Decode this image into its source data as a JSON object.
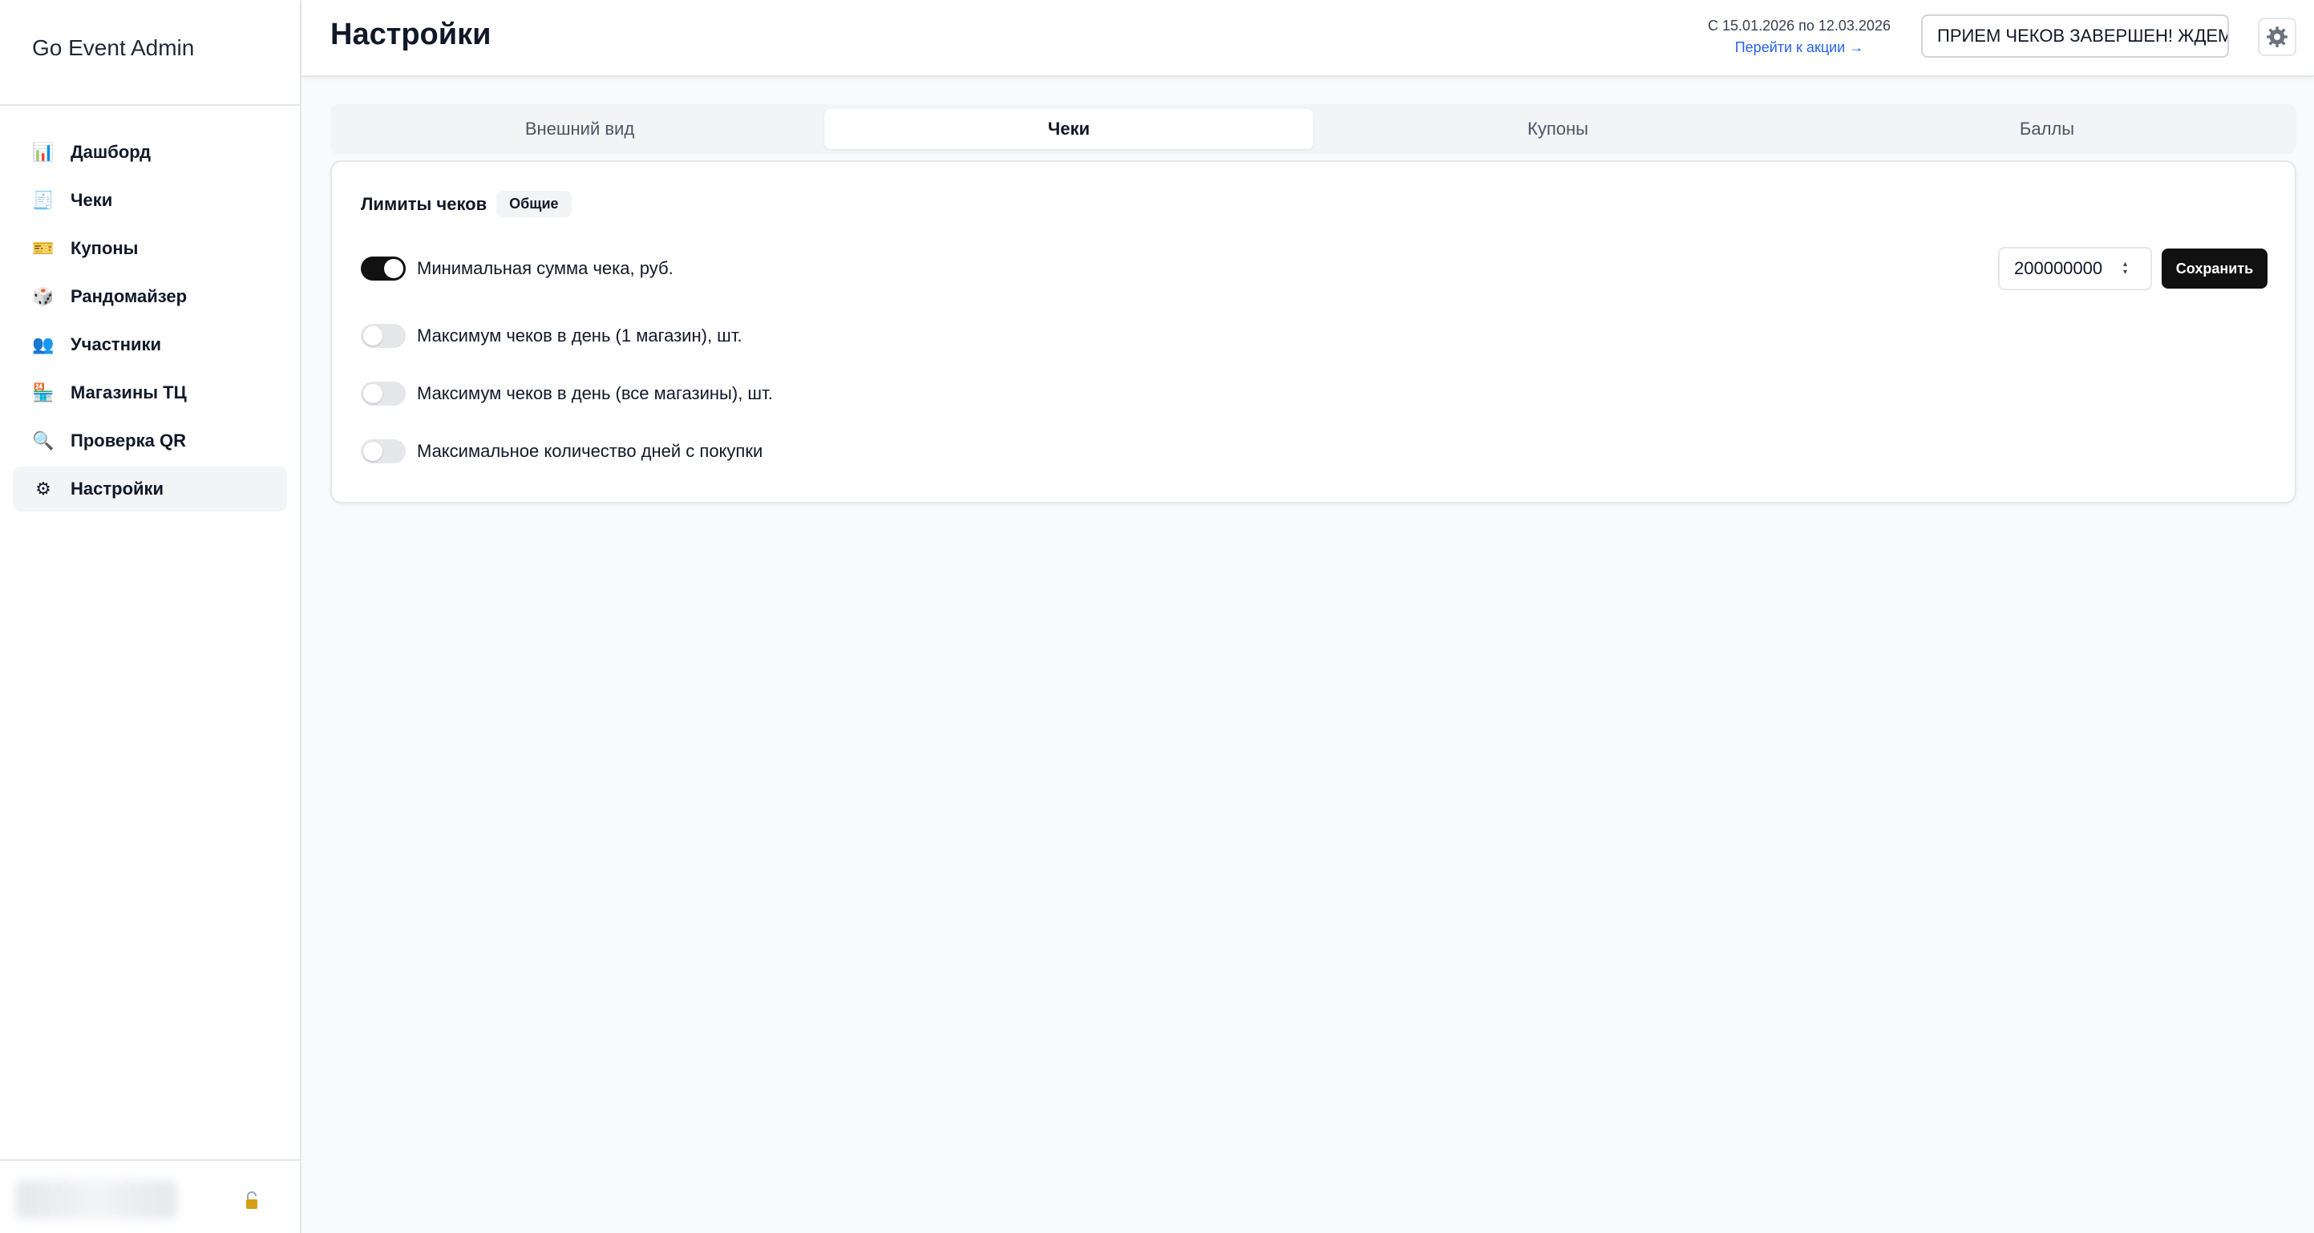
{
  "app": {
    "brand": "Go Event Admin"
  },
  "sidebar": {
    "items": [
      {
        "label": "Дашборд",
        "icon": "bar-chart-icon",
        "glyph": "📊",
        "active": false
      },
      {
        "label": "Чеки",
        "icon": "receipt-icon",
        "glyph": "🧾",
        "active": false
      },
      {
        "label": "Купоны",
        "icon": "ticket-icon",
        "glyph": "🎫",
        "active": false
      },
      {
        "label": "Рандомайзер",
        "icon": "dice-icon",
        "glyph": "🎲",
        "active": false
      },
      {
        "label": "Участники",
        "icon": "users-icon",
        "glyph": "👥",
        "active": false
      },
      {
        "label": "Магазины ТЦ",
        "icon": "store-icon",
        "glyph": "🏪",
        "active": false
      },
      {
        "label": "Проверка QR",
        "icon": "magnifier-icon",
        "glyph": "🔍",
        "active": false
      },
      {
        "label": "Настройки",
        "icon": "gear-icon",
        "glyph": "⚙",
        "active": true
      }
    ]
  },
  "header": {
    "title": "Настройки",
    "date_range": "С 15.01.2026 по 12.03.2026",
    "promo_link": "Перейти к акции →",
    "status_text": "ПРИЕМ ЧЕКОВ ЗАВЕРШЕН! ЖДЕМ"
  },
  "tabs": [
    {
      "label": "Внешний вид",
      "active": false
    },
    {
      "label": "Чеки",
      "active": true
    },
    {
      "label": "Купоны",
      "active": false
    },
    {
      "label": "Баллы",
      "active": false
    }
  ],
  "limits": {
    "title": "Лимиты чеков",
    "badge": "Общие",
    "rows": [
      {
        "label": "Минимальная сумма чека, руб.",
        "enabled": true
      },
      {
        "label": "Максимум чеков в день (1 магазин), шт.",
        "enabled": false
      },
      {
        "label": "Максимум чеков в день (все магазины), шт.",
        "enabled": false
      },
      {
        "label": "Максимальное количество дней с покупки",
        "enabled": false
      }
    ],
    "min_amount_value": "200000000",
    "save_label": "Сохранить"
  }
}
